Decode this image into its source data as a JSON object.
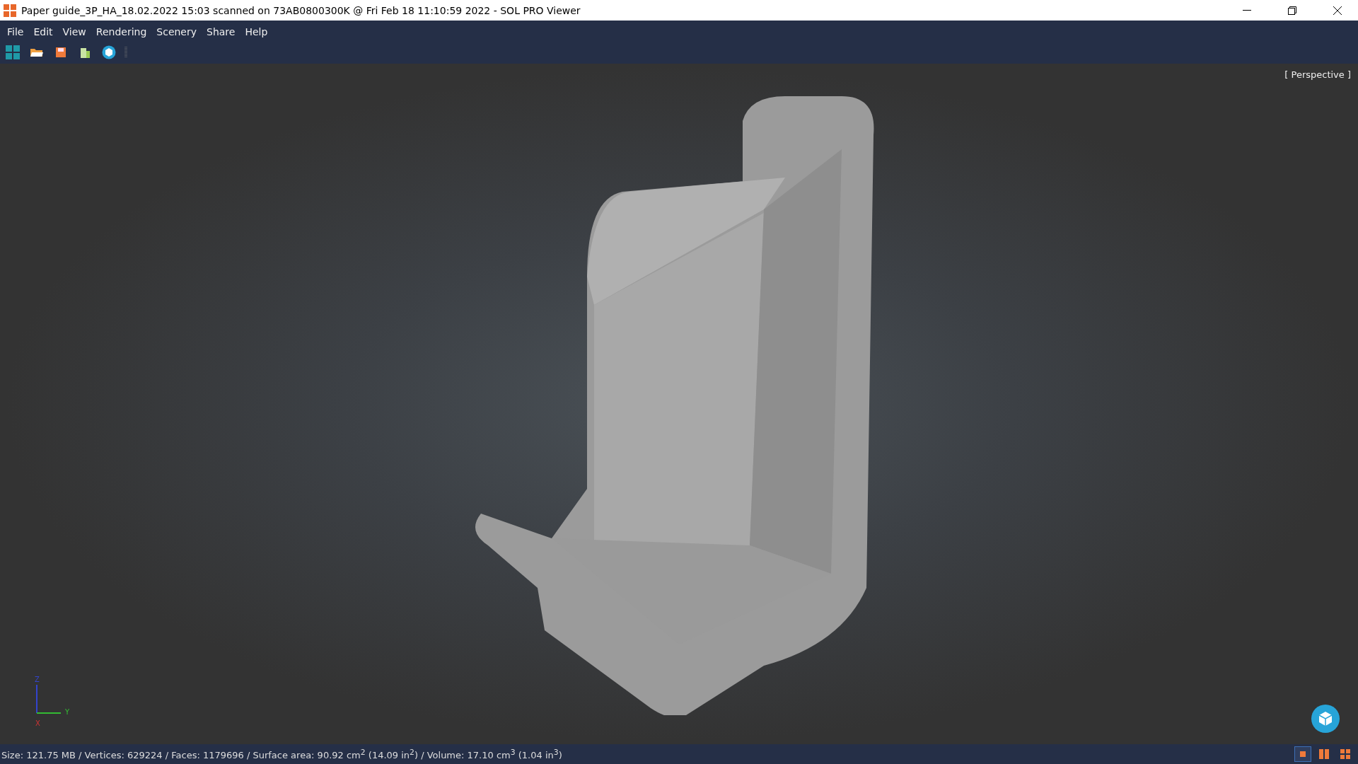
{
  "window": {
    "title": "Paper guide_3P_HA_18.02.2022 15:03 scanned on 73AB0800300K @ Fri Feb 18 11:10:59 2022 - SOL PRO Viewer"
  },
  "menu": [
    "File",
    "Edit",
    "View",
    "Rendering",
    "Scenery",
    "Share",
    "Help"
  ],
  "toolbar": [
    {
      "kind": "grid"
    },
    {
      "kind": "open"
    },
    {
      "kind": "save"
    },
    {
      "kind": "plugin"
    },
    {
      "kind": "cube"
    }
  ],
  "viewport": {
    "projection": "[ Perspective ]",
    "axes": [
      "Z",
      "Y",
      "X"
    ]
  },
  "status_bar": {
    "text": "Size: 121.75 MB / Vertices: 629224 / Faces: 1179696 / Surface area: 90.92 cm$^{2}$ (14.09 in$^{2}$) / Volume: 17.10 cm$^{3}$ (1.04 in$^{3}$)",
    "layouts": [
      {
        "kind": "single",
        "selected": true
      },
      {
        "kind": "double",
        "selected": false
      },
      {
        "kind": "quad",
        "selected": false
      }
    ]
  }
}
